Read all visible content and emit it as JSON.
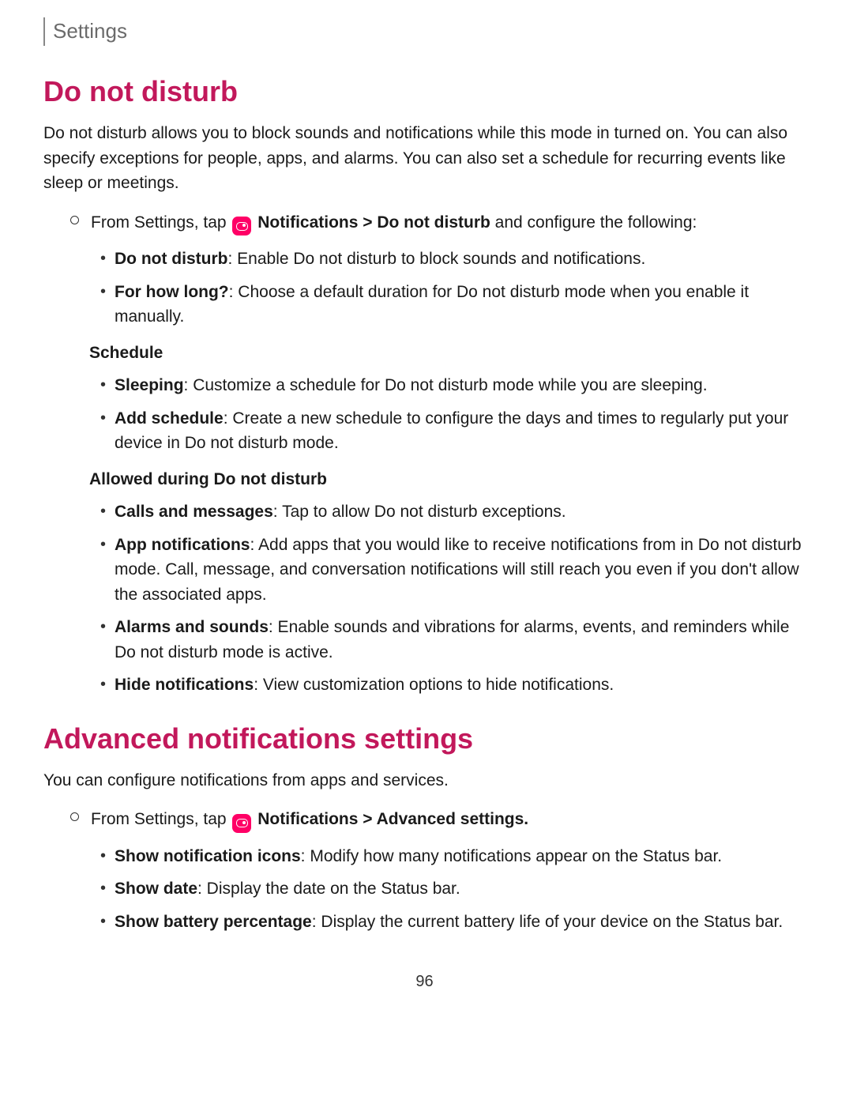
{
  "breadcrumb": "Settings",
  "section1": {
    "title": "Do not disturb",
    "intro": "Do not disturb allows you to block sounds and notifications while this mode in turned on. You can also specify exceptions for people, apps, and alarms. You can also set a schedule for recurring events like sleep or meetings.",
    "step_prefix": "From Settings, tap ",
    "step_path": "Notifications > Do not disturb",
    "step_suffix": " and configure the following:",
    "items_top": [
      {
        "term": "Do not disturb",
        "desc": ": Enable Do not disturb to block sounds and notifications."
      },
      {
        "term": "For how long?",
        "desc": ": Choose a default duration for Do not disturb mode when you enable it manually."
      }
    ],
    "group1_title": "Schedule",
    "group1_items": [
      {
        "term": "Sleeping",
        "desc": ": Customize a schedule for Do not disturb mode while you are sleeping."
      },
      {
        "term": "Add schedule",
        "desc": ": Create a new schedule to configure the days and times to regularly put your device in Do not disturb mode."
      }
    ],
    "group2_title": "Allowed during Do not disturb",
    "group2_items": [
      {
        "term": "Calls and messages",
        "desc": ": Tap to allow Do not disturb exceptions."
      },
      {
        "term": "App notifications",
        "desc": ": Add apps that you would like to receive notifications from in Do not disturb mode. Call, message, and conversation notifications will still reach you even if you don't allow the associated apps."
      },
      {
        "term": "Alarms and sounds",
        "desc": ": Enable sounds and vibrations for alarms, events, and reminders while Do not disturb mode is active."
      },
      {
        "term": "Hide notifications",
        "desc": ": View customization options to hide notifications."
      }
    ]
  },
  "section2": {
    "title": "Advanced notifications settings",
    "intro": "You can configure notifications from apps and services.",
    "step_prefix": "From Settings, tap ",
    "step_path": "Notifications > Advanced settings.",
    "items": [
      {
        "term": "Show notification icons",
        "desc": ": Modify how many notifications appear on the Status bar."
      },
      {
        "term": "Show date",
        "desc": ": Display the date on the Status bar."
      },
      {
        "term": "Show battery percentage",
        "desc": ": Display the current battery life of your device on the Status bar."
      }
    ]
  },
  "page_number": "96"
}
